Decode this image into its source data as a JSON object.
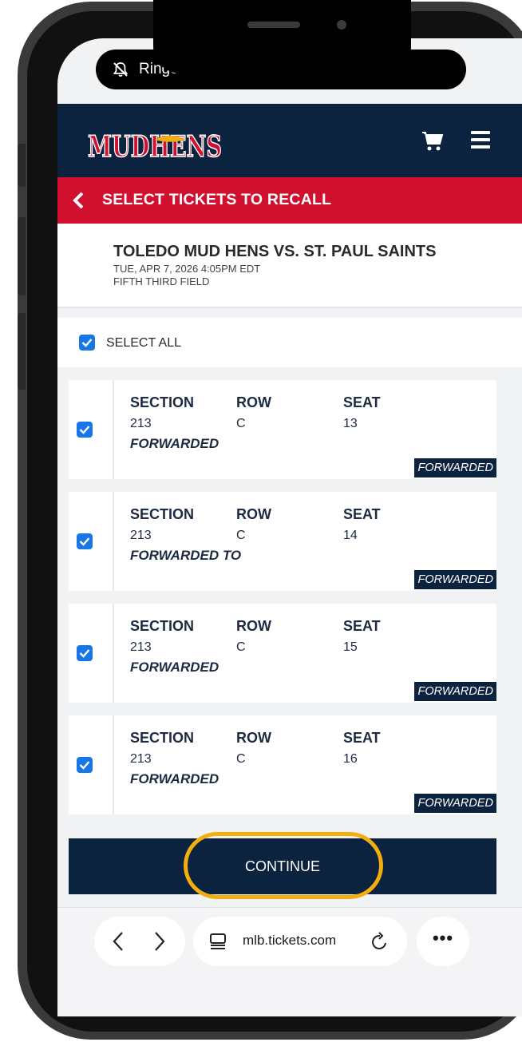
{
  "status_bar": {
    "ringer_label": "Ringer"
  },
  "header": {
    "logo_text": "MUDHENS"
  },
  "title_bar": {
    "title": "SELECT TICKETS TO RECALL"
  },
  "event": {
    "name": "TOLEDO MUD HENS VS. ST. PAUL SAINTS",
    "datetime": "TUE, APR 7, 2026 4:05PM EDT",
    "venue": "FIFTH THIRD FIELD"
  },
  "select_all": {
    "label": "SELECT ALL",
    "checked": true
  },
  "columns": {
    "section": "SECTION",
    "row": "ROW",
    "seat": "SEAT"
  },
  "tickets": [
    {
      "section": "213",
      "row": "C",
      "seat": "13",
      "status": "FORWARDED",
      "badge": "FORWARDED",
      "checked": true
    },
    {
      "section": "213",
      "row": "C",
      "seat": "14",
      "status": "FORWARDED TO",
      "badge": "FORWARDED",
      "checked": true
    },
    {
      "section": "213",
      "row": "C",
      "seat": "15",
      "status": "FORWARDED",
      "badge": "FORWARDED",
      "checked": true
    },
    {
      "section": "213",
      "row": "C",
      "seat": "16",
      "status": "FORWARDED",
      "badge": "FORWARDED",
      "checked": true
    }
  ],
  "continue_button": {
    "label": "CONTINUE"
  },
  "browser": {
    "url": "mlb.tickets.com",
    "more_label": "•••"
  },
  "colors": {
    "navy": "#0c2340",
    "red": "#d0102e",
    "checkbox": "#1876e8",
    "highlight": "#f2ad0f"
  }
}
